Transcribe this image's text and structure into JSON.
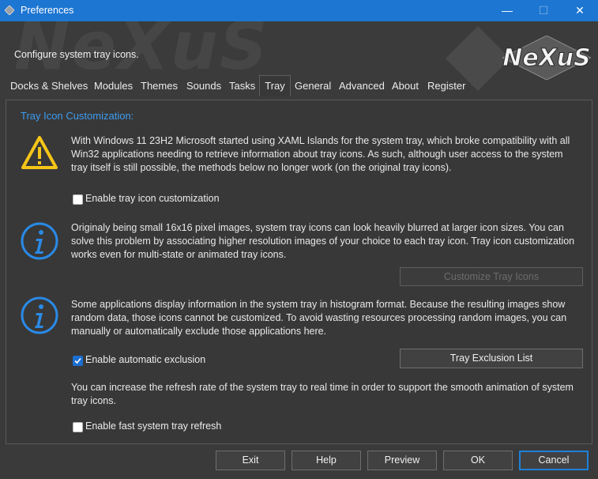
{
  "window": {
    "title": "Preferences",
    "minimize": "—",
    "maximize": "☐",
    "close": "✕"
  },
  "header": {
    "subtitle": "Configure system tray icons.",
    "watermark": "NeXuS",
    "logo_text": "NeXuS"
  },
  "tabs": [
    {
      "label": "Docks & Shelves",
      "active": false
    },
    {
      "label": "Modules",
      "active": false
    },
    {
      "label": "Themes",
      "active": false
    },
    {
      "label": "Sounds",
      "active": false
    },
    {
      "label": "Tasks",
      "active": false
    },
    {
      "label": "Tray",
      "active": true
    },
    {
      "label": "General",
      "active": false
    },
    {
      "label": "Advanced",
      "active": false
    },
    {
      "label": "About",
      "active": false
    },
    {
      "label": "Register",
      "active": false
    }
  ],
  "panel": {
    "title": "Tray Icon Customization:",
    "warning_text": "With Windows 11 23H2 Microsoft started using XAML Islands for the system tray, which broke compatibility with all Win32 applications needing to retrieve information about tray icons. As such, although user access to the system tray itself is still possible, the methods below no longer work (on the original tray icons).",
    "enable_customization": {
      "label": "Enable tray icon customization",
      "checked": false
    },
    "info1_text": "Originaly being small 16x16 pixel images, system tray icons can look heavily blurred at larger icon sizes. You can solve this problem by associating higher resolution images of your choice to each tray icon. Tray icon customization works even for multi-state or animated tray icons.",
    "customize_button": "Customize Tray Icons",
    "info2_text": "Some applications display information in the system tray in histogram format. Because the resulting images show random data, those icons cannot be customized. To avoid wasting resources processing random images, you can manually or automatically exclude those applications here.",
    "auto_exclusion": {
      "label": "Enable automatic exclusion",
      "checked": true
    },
    "exclusion_button": "Tray Exclusion List",
    "refresh_text": "You can increase the refresh rate of the system tray to real time in order to support the smooth animation of system tray icons.",
    "fast_refresh": {
      "label": "Enable fast system tray refresh",
      "checked": false
    }
  },
  "footer": {
    "exit": "Exit",
    "help": "Help",
    "preview": "Preview",
    "ok": "OK",
    "cancel": "Cancel"
  },
  "colors": {
    "titlebar": "#1d76d2",
    "accent": "#3d9cf0",
    "warning": "#f5c518",
    "info": "#2a8ae6"
  }
}
